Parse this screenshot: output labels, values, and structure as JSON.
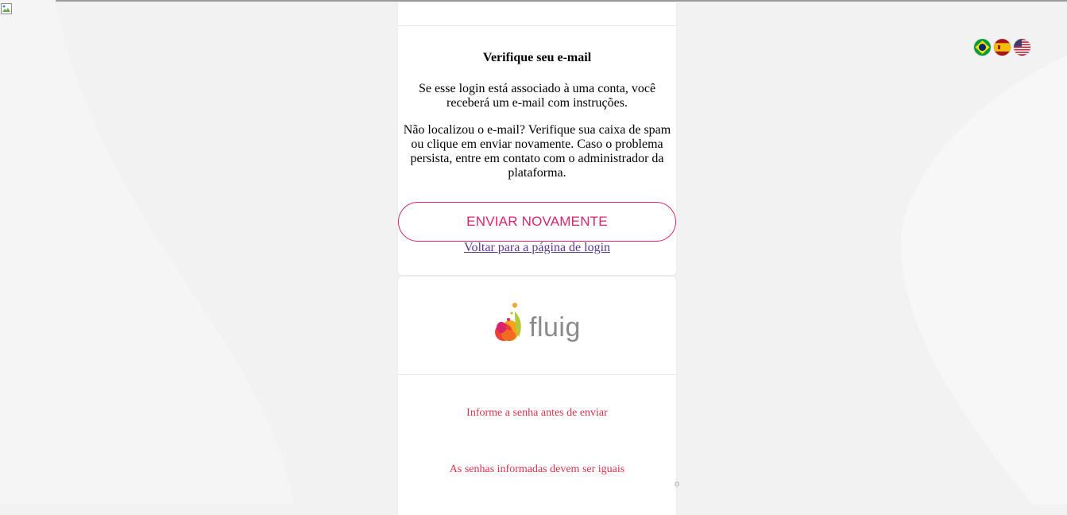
{
  "languages": [
    {
      "name": "brazil-flag-icon",
      "colors": [
        "#009c3b",
        "#ffdf00",
        "#002776"
      ]
    },
    {
      "name": "spain-flag-icon",
      "colors": [
        "#aa151b",
        "#f1bf00"
      ]
    },
    {
      "name": "usa-flag-icon",
      "colors": [
        "#b22234",
        "#ffffff",
        "#3c3b6e"
      ]
    }
  ],
  "verify": {
    "title": "Verifique seu e-mail",
    "message": "Se esse login está associado à uma conta, você receberá um e-mail com instruções.",
    "help": "Não localizou o e-mail? Verifique sua caixa de spam ou clique em enviar novamente. Caso o problema persista, entre em contato com o administrador da plataforma.",
    "resend_label": "ENVIAR NOVAMENTE",
    "back_label": "Voltar para a página de login"
  },
  "brand": {
    "logo_text": "fluig",
    "accent": "#d9246e"
  },
  "errors": {
    "password_required": "Informe a senha antes de enviar",
    "passwords_mismatch": "As senhas informadas devem ser iguais",
    "color": "#d9344d"
  },
  "stray_char": "o"
}
